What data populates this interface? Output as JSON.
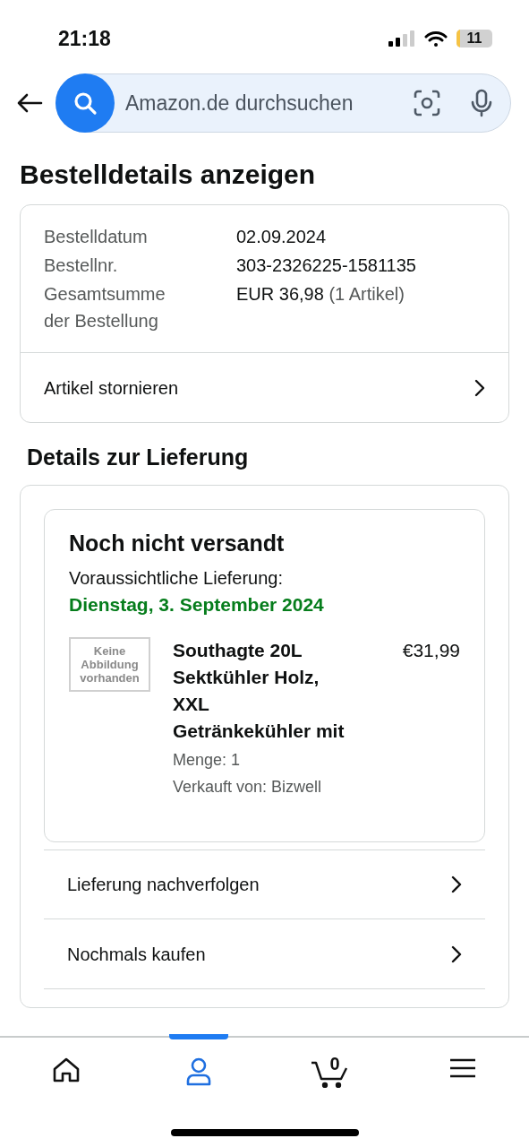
{
  "status_bar": {
    "time": "21:18",
    "battery": "11"
  },
  "search": {
    "placeholder": "Amazon.de durchsuchen"
  },
  "title": "Bestelldetails anzeigen",
  "order": {
    "fields": [
      {
        "label": "Bestelldatum",
        "value": "02.09.2024"
      },
      {
        "label": "Bestellnr.",
        "value": "303-2326225-1581135"
      },
      {
        "label": "Gesamtsumme der Bestellung",
        "value": "EUR 36,98",
        "note": "(1 Artikel)"
      }
    ],
    "action": "Artikel stornieren"
  },
  "delivery": {
    "heading": "Details zur Lieferung",
    "status": "Noch nicht versandt",
    "expected_label": "Voraussichtliche Lieferung:",
    "expected_date": "Dienstag, 3. September 2024",
    "item": {
      "image_text": "Keine Abbildung vorhanden",
      "name": "Southagte 20L Sektkühler Holz, XXL Getränkekühler mit",
      "price": "€31,99",
      "quantity": "Menge: 1",
      "seller": "Verkauft von: Bizwell"
    },
    "actions": [
      "Lieferung nachverfolgen",
      "Nochmals kaufen"
    ]
  },
  "nav": [
    {
      "kind": "home",
      "selected": false
    },
    {
      "kind": "account",
      "selected": true
    },
    {
      "kind": "cart",
      "selected": false,
      "count": "0"
    },
    {
      "kind": "menu",
      "selected": false
    }
  ]
}
